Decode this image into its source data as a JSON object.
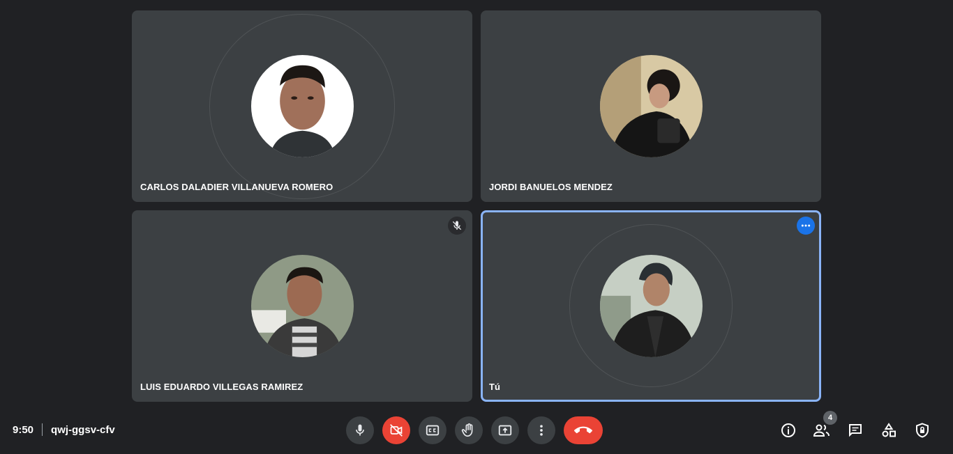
{
  "participants": [
    {
      "name": "CARLOS DALADIER VILLANUEVA ROMERO"
    },
    {
      "name": "JORDI BANUELOS MENDEZ"
    },
    {
      "name": "LUIS EDUARDO VILLEGAS RAMIREZ",
      "muted": true
    },
    {
      "name": "Tú",
      "is_self": true
    }
  ],
  "meeting": {
    "time": "9:50",
    "code": "qwj-ggsv-cfv"
  },
  "people_count": "4",
  "icons": {
    "mic": "microphone-icon",
    "camera_off": "camera-off-icon",
    "captions": "captions-icon",
    "hand": "raise-hand-icon",
    "present": "present-screen-icon",
    "more": "more-vert-icon",
    "hangup": "call-end-icon",
    "info": "info-icon",
    "people": "people-icon",
    "chat": "chat-icon",
    "activities": "activities-icon",
    "host": "host-controls-icon"
  },
  "colors": {
    "background": "#202124",
    "tile": "#3c4043",
    "active_border": "#8ab4f8",
    "danger": "#ea4335",
    "accent": "#1a73e8"
  }
}
